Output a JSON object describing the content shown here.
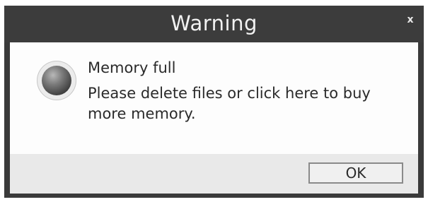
{
  "dialog": {
    "title": "Warning",
    "close_label": "x",
    "icon": "info-orb-icon",
    "message_title": "Memory full",
    "message_body": "Please delete files or click here to buy more memory.",
    "ok_label": "OK"
  }
}
